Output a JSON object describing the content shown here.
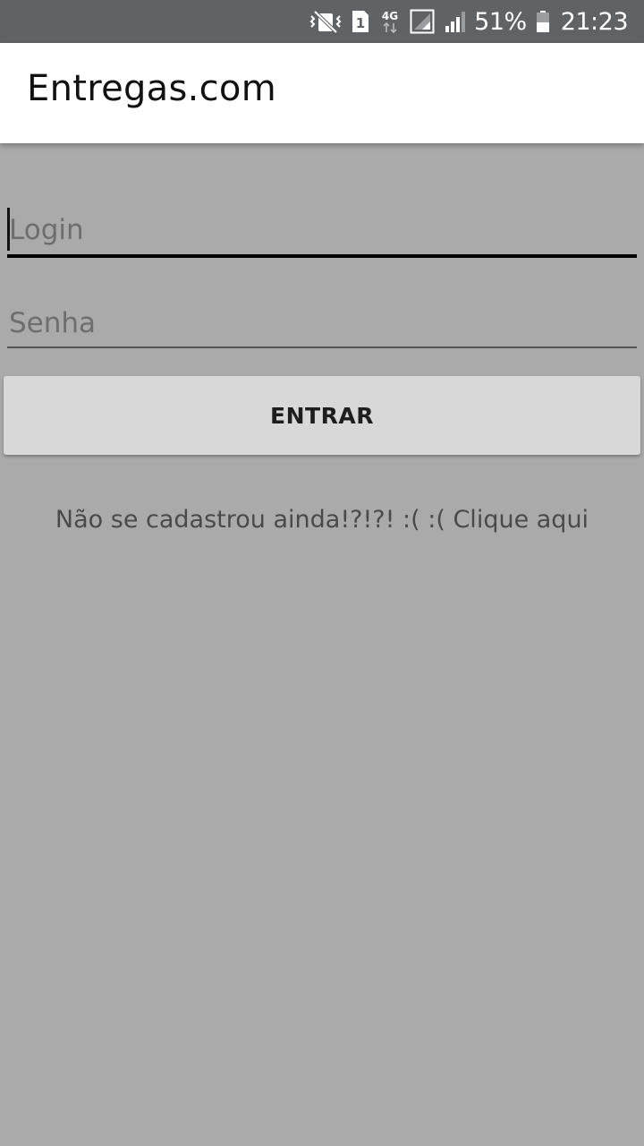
{
  "status_bar": {
    "icons": [
      "vibrate-icon",
      "sim-1-icon",
      "4g-icon",
      "signal-sim1-icon",
      "signal-sim2-icon",
      "battery-icon"
    ],
    "sim_label": "1",
    "network_label": "4G",
    "battery_percent": "51%",
    "battery_level": 0.51,
    "time": "21:23",
    "background_color": "#5f6366"
  },
  "app_bar": {
    "title": "Entregas.com"
  },
  "form": {
    "login": {
      "placeholder": "Login",
      "value": ""
    },
    "senha": {
      "placeholder": "Senha",
      "value": ""
    },
    "submit_label": "ENTRAR",
    "signup_text": "Não se cadastrou ainda!?!?! :( :( Clique aqui"
  },
  "colors": {
    "background": "#aaaaaa",
    "button": "#d7d8d7",
    "app_bar": "#ffffff"
  }
}
